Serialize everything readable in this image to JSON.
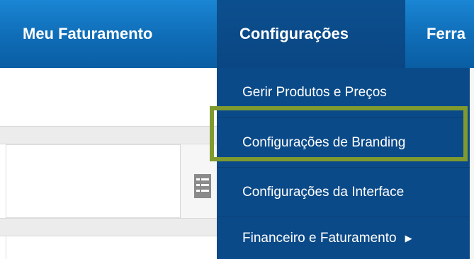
{
  "nav": {
    "billing": "Meu Faturamento",
    "config": "Configurações",
    "tools": "Ferra"
  },
  "dropdown": {
    "items": [
      {
        "label": "Gerir Produtos e Preços"
      },
      {
        "label": "Configurações de Branding",
        "highlighted": true
      },
      {
        "label": "Configurações da Interface"
      },
      {
        "label": "Financeiro e Faturamento",
        "submenu_icon": "caret-right-icon"
      }
    ],
    "submenu_glyph": "▶"
  },
  "colors": {
    "nav_blue": "#0f6cb6",
    "nav_active": "#0b4a88",
    "highlight": "#7f9a2f"
  }
}
